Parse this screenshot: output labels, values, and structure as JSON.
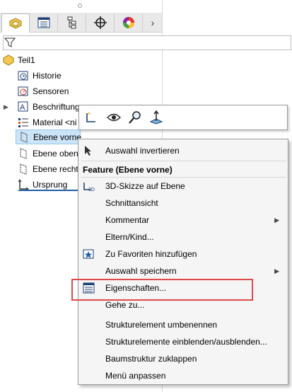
{
  "tree": {
    "root": "Teil1",
    "items": [
      {
        "label": "Historie",
        "icon": "history-icon"
      },
      {
        "label": "Sensoren",
        "icon": "sensor-icon"
      },
      {
        "label": "Beschriftungen",
        "icon": "annotations-icon"
      },
      {
        "label": "Material <nicht festgelegt>",
        "icon": "material-icon"
      },
      {
        "label": "Ebene vorne",
        "icon": "plane-icon"
      },
      {
        "label": "Ebene oben",
        "icon": "plane-icon"
      },
      {
        "label": "Ebene rechts",
        "icon": "plane-icon"
      },
      {
        "label": "Ursprung",
        "icon": "origin-icon"
      }
    ],
    "visible": [
      "Beschriftung",
      "Material <ni",
      "Ebene vorne",
      "Ebene oben",
      "Ebene recht",
      "Ursprung"
    ]
  },
  "menu": {
    "top_item": "Auswahl invertieren",
    "header": "Feature (Ebene vorne)",
    "items": [
      "3D-Skizze auf Ebene",
      "Schnittansicht",
      "Kommentar",
      "Eltern/Kind...",
      "Zu Favoriten hinzufügen",
      "Auswahl speichern",
      "Eigenschaften...",
      "Gehe zu...",
      "Strukturelement umbenennen",
      "Strukturelemente einblenden/ausblenden...",
      "Baumstruktur zuklappen",
      "Menü anpassen"
    ]
  },
  "colors": {
    "selection": "#cce4f7",
    "highlight_box": "#e04a4a",
    "menu_bg": "#f5f5f5"
  }
}
